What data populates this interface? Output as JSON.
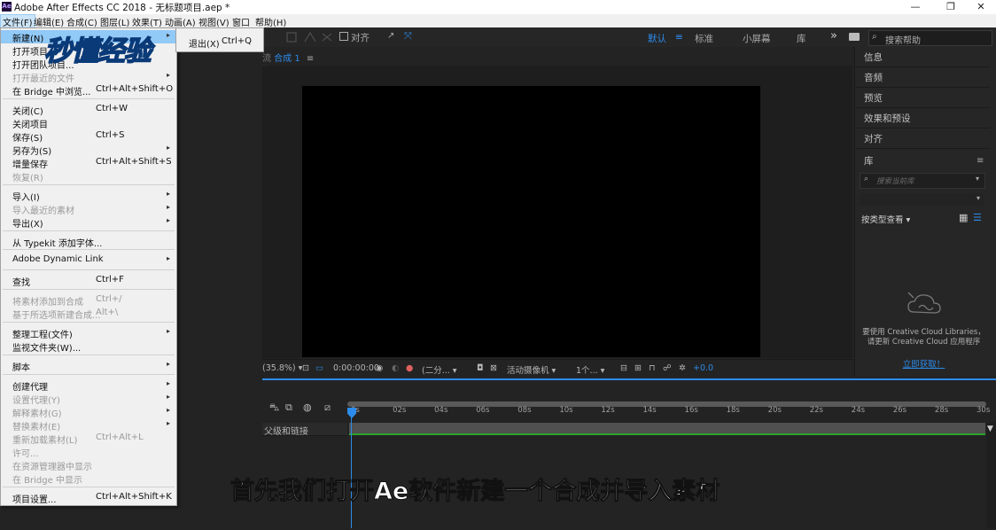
{
  "app": {
    "title": "Adobe After Effects CC 2018 - 无标题项目.aep *",
    "logo": "Ae",
    "window_controls": {
      "minimize": "—",
      "maximize": "❐",
      "close": "✕"
    }
  },
  "menubar": [
    "文件(F)",
    "编辑(E)",
    "合成(C)",
    "图层(L)",
    "效果(T)",
    "动画(A)",
    "视图(V)",
    "窗口",
    "帮助(H)"
  ],
  "toolbar": {
    "align_label": "对齐",
    "workspaces": [
      "默认",
      "标准",
      "小屏幕",
      "库"
    ],
    "more": "»",
    "search_placeholder": "搜索帮助"
  },
  "file_menu": {
    "items": [
      {
        "label": "新建(N)",
        "shortcut": "",
        "submenu": true,
        "disabled": false
      },
      {
        "label": "打开项目...",
        "shortcut": "",
        "submenu": false,
        "disabled": false
      },
      {
        "label": "打开团队项目...",
        "shortcut": "",
        "submenu": false,
        "disabled": false
      },
      {
        "label": "打开最近的文件",
        "shortcut": "",
        "submenu": true,
        "disabled": true
      },
      {
        "label": "在 Bridge 中浏览...",
        "shortcut": "Ctrl+Alt+Shift+O",
        "submenu": false,
        "disabled": false
      },
      {
        "label": "关闭(C)",
        "shortcut": "Ctrl+W",
        "submenu": false,
        "disabled": false
      },
      {
        "label": "关闭项目",
        "shortcut": "",
        "submenu": false,
        "disabled": false
      },
      {
        "label": "保存(S)",
        "shortcut": "Ctrl+S",
        "submenu": false,
        "disabled": false
      },
      {
        "label": "另存为(S)",
        "shortcut": "",
        "submenu": true,
        "disabled": false
      },
      {
        "label": "增量保存",
        "shortcut": "Ctrl+Alt+Shift+S",
        "submenu": false,
        "disabled": false
      },
      {
        "label": "恢复(R)",
        "shortcut": "",
        "submenu": false,
        "disabled": true
      },
      {
        "label": "导入(I)",
        "shortcut": "",
        "submenu": true,
        "disabled": false
      },
      {
        "label": "导入最近的素材",
        "shortcut": "",
        "submenu": true,
        "disabled": true
      },
      {
        "label": "导出(X)",
        "shortcut": "",
        "submenu": true,
        "disabled": false
      },
      {
        "label": "从 Typekit 添加字体...",
        "shortcut": "",
        "submenu": false,
        "disabled": false
      },
      {
        "label": "Adobe Dynamic Link",
        "shortcut": "",
        "submenu": true,
        "disabled": false
      },
      {
        "label": "查找",
        "shortcut": "Ctrl+F",
        "submenu": false,
        "disabled": false
      },
      {
        "label": "将素材添加到合成",
        "shortcut": "Ctrl+/",
        "submenu": false,
        "disabled": true
      },
      {
        "label": "基于所选项新建合成...",
        "shortcut": "Alt+\\",
        "submenu": false,
        "disabled": true
      },
      {
        "label": "整理工程(文件)",
        "shortcut": "",
        "submenu": true,
        "disabled": false
      },
      {
        "label": "监视文件夹(W)...",
        "shortcut": "",
        "submenu": false,
        "disabled": false
      },
      {
        "label": "脚本",
        "shortcut": "",
        "submenu": true,
        "disabled": false
      },
      {
        "label": "创建代理",
        "shortcut": "",
        "submenu": true,
        "disabled": false
      },
      {
        "label": "设置代理(Y)",
        "shortcut": "",
        "submenu": true,
        "disabled": true
      },
      {
        "label": "解释素材(G)",
        "shortcut": "",
        "submenu": true,
        "disabled": true
      },
      {
        "label": "替换素材(E)",
        "shortcut": "",
        "submenu": true,
        "disabled": true
      },
      {
        "label": "重新加载素材(L)",
        "shortcut": "Ctrl+Alt+L",
        "submenu": false,
        "disabled": true
      },
      {
        "label": "许可...",
        "shortcut": "",
        "submenu": false,
        "disabled": true
      },
      {
        "label": "在资源管理器中显示",
        "shortcut": "",
        "submenu": false,
        "disabled": true
      },
      {
        "label": "在 Bridge 中显示",
        "shortcut": "",
        "submenu": false,
        "disabled": true
      },
      {
        "label": "项目设置...",
        "shortcut": "Ctrl+Alt+Shift+K",
        "submenu": false,
        "disabled": false
      }
    ]
  },
  "submenu": {
    "label": "退出(X)",
    "shortcut": "Ctrl+Q"
  },
  "composition": {
    "tab_label": "合成 1",
    "viewer_bar": {
      "zoom": "(35.8%)",
      "timecode": "0:00:00:00",
      "resolution": "(二分...",
      "camera": "活动摄像机",
      "views": "1个...",
      "exposure": "+0.0"
    }
  },
  "right_panel": {
    "items": [
      "信息",
      "音频",
      "预览",
      "效果和预设",
      "对齐",
      "库"
    ],
    "library": {
      "search_placeholder": "搜索当前库",
      "view_by": "按类型查看",
      "message": "要使用 Creative Cloud Libraries，请更新 Creative Cloud 应用程序",
      "action": "立即获取！"
    }
  },
  "timeline": {
    "ticks": [
      "0s",
      "02s",
      "04s",
      "06s",
      "08s",
      "10s",
      "12s",
      "14s",
      "16s",
      "18s",
      "20s",
      "22s",
      "24s",
      "26s",
      "28s",
      "30s"
    ],
    "parent_column": "父级和链接"
  },
  "overlay": {
    "watermark": "秒懂经验",
    "subtitle": "首先我们打开Ae软件新建一个合成并导入素材"
  },
  "colors": {
    "accent": "#2d8ceb",
    "menu_highlight": "#91c9f7",
    "work_area_green": "#2aa52a"
  }
}
